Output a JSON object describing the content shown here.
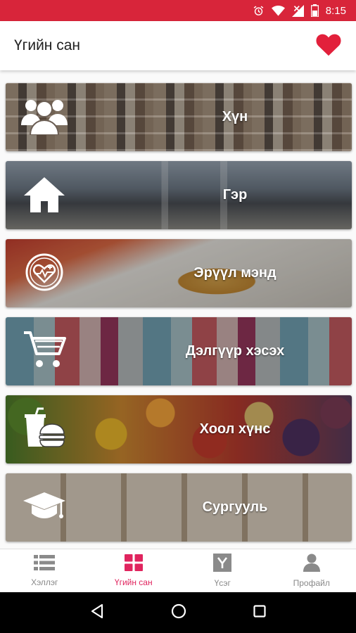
{
  "status_bar": {
    "time": "8:15",
    "icons": [
      "alarm-icon",
      "wifi-icon",
      "signal-icon",
      "battery-icon"
    ]
  },
  "app_bar": {
    "title": "Үгийн сан",
    "action_icon": "heart-icon"
  },
  "categories": [
    {
      "label": "Хүн",
      "icon": "people-icon"
    },
    {
      "label": "Гэр",
      "icon": "home-icon"
    },
    {
      "label": "Эрүүл мэнд",
      "icon": "health-icon"
    },
    {
      "label": "Дэлгүүр хэсэх",
      "icon": "cart-icon"
    },
    {
      "label": "Хоол хүнс",
      "icon": "food-icon"
    },
    {
      "label": "Сургууль",
      "icon": "graduation-cap-icon"
    }
  ],
  "bottom_nav": [
    {
      "label": "Хэллэг",
      "icon": "list-icon",
      "active": false
    },
    {
      "label": "Үгийн сан",
      "icon": "grid-icon",
      "active": true
    },
    {
      "label": "Үсэг",
      "icon": "letter-y-icon",
      "active": false
    },
    {
      "label": "Профайл",
      "icon": "person-icon",
      "active": false
    }
  ],
  "colors": {
    "status_bar": "#d8253a",
    "accent": "#e0245e",
    "heart": "#e2203b",
    "inactive": "#8a8a8a"
  }
}
